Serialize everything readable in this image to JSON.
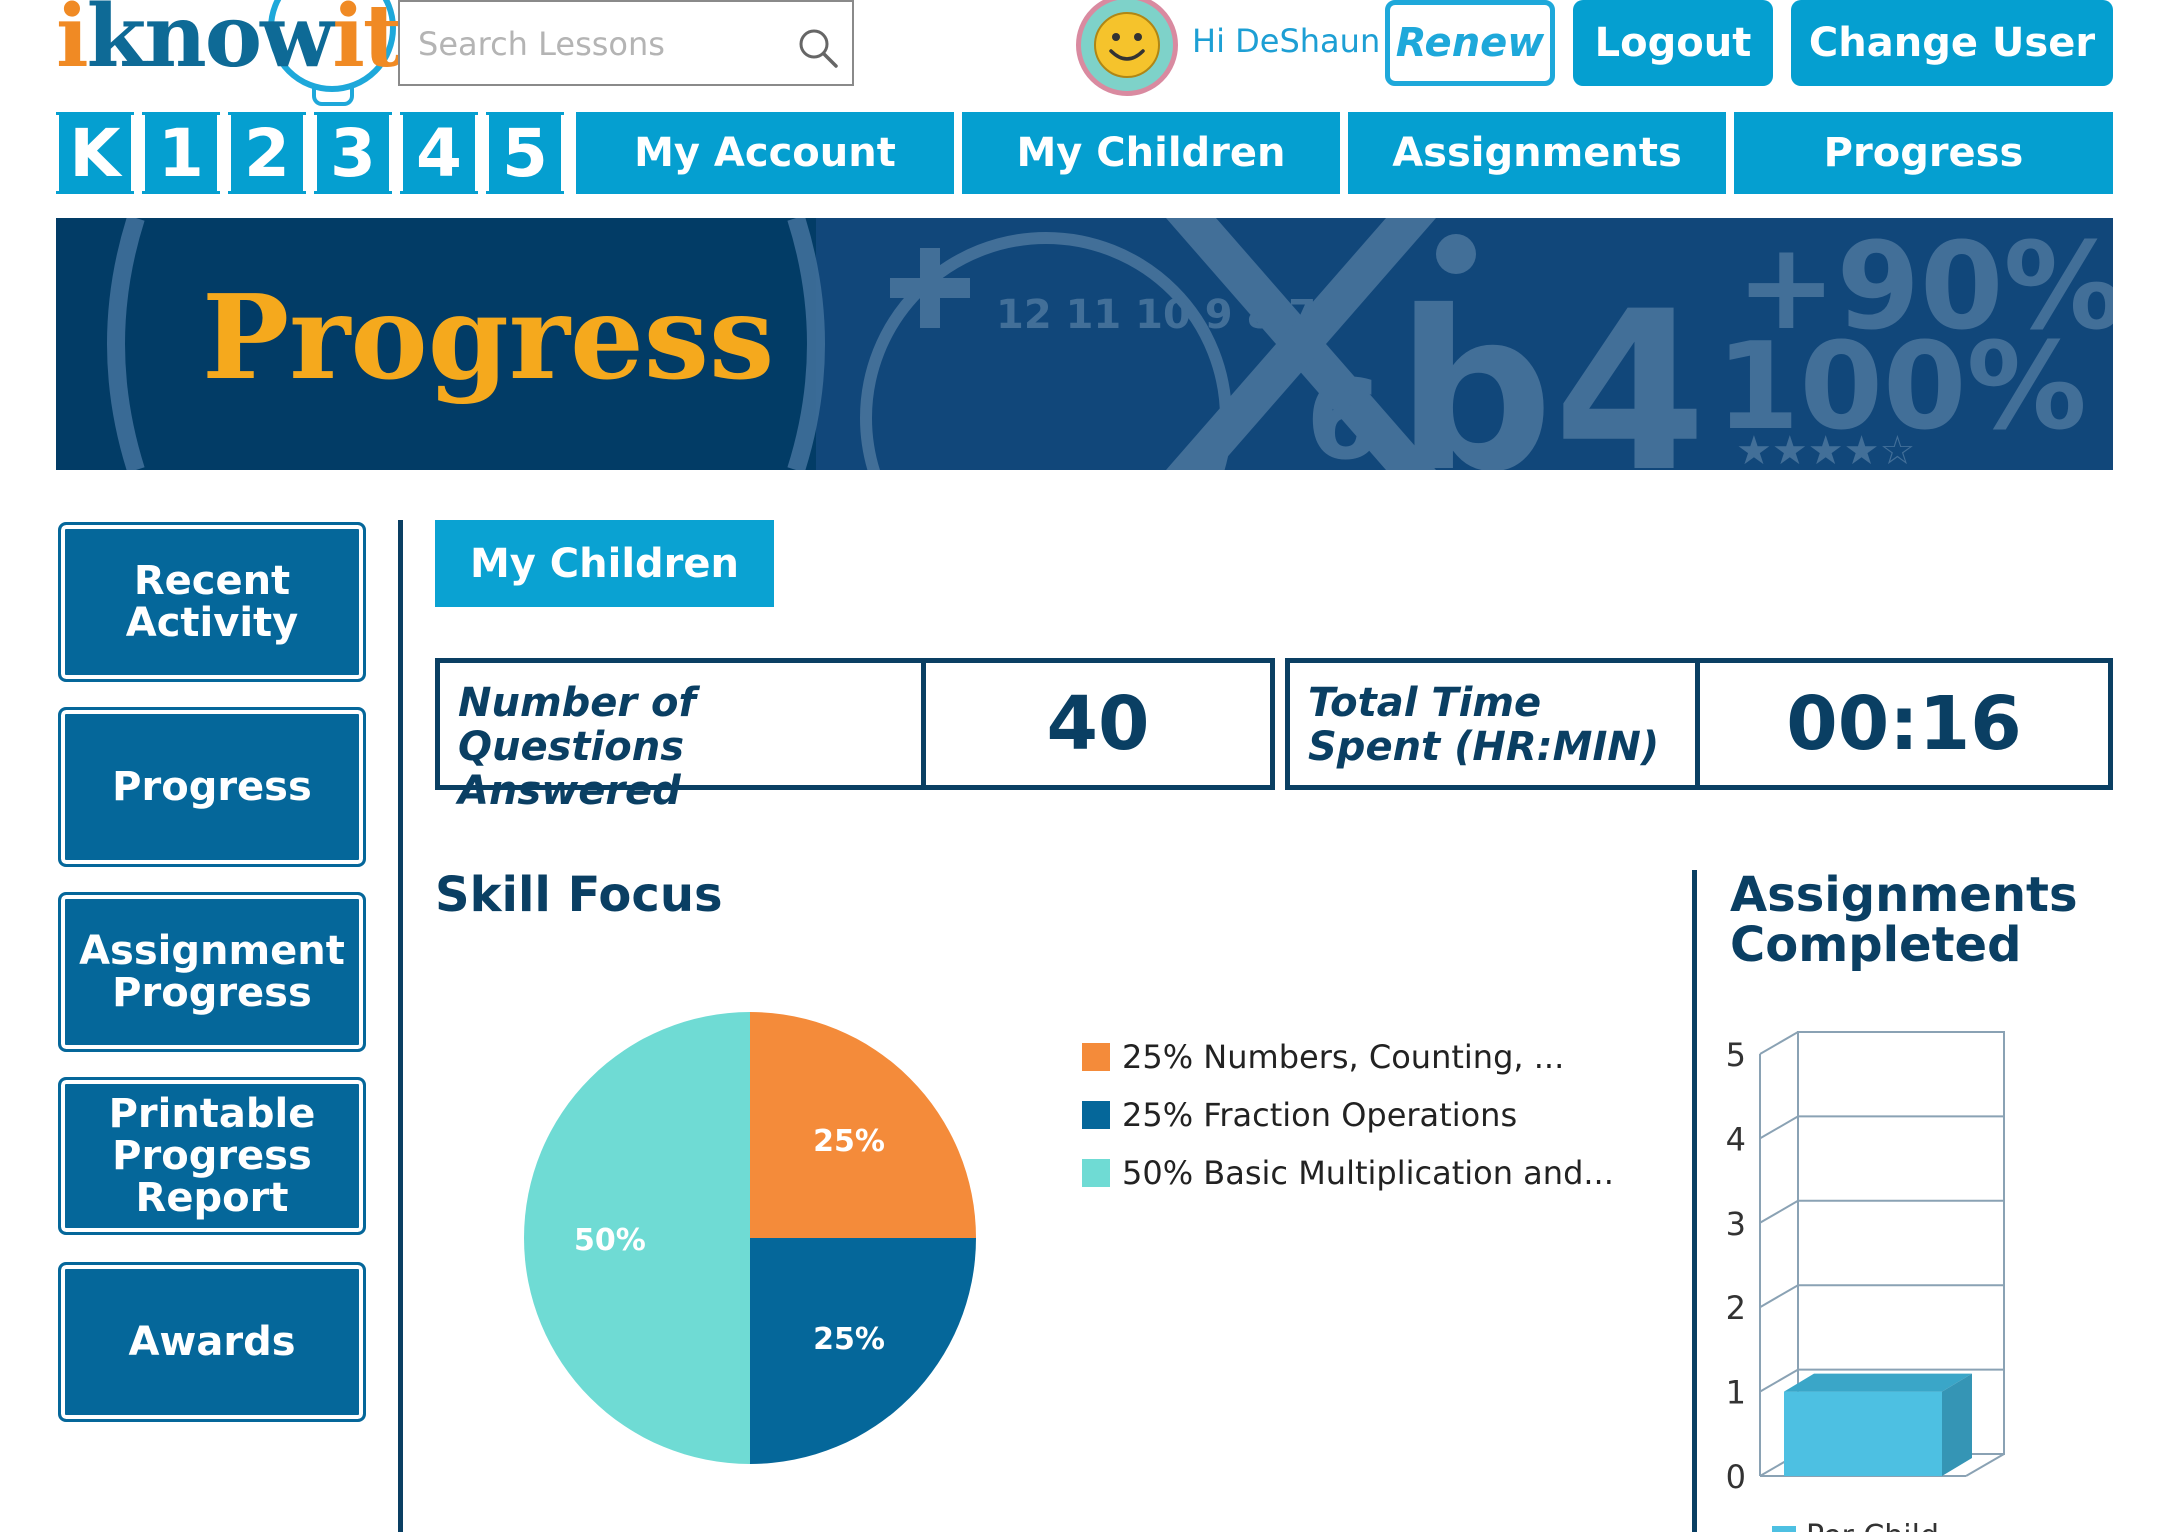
{
  "header": {
    "logo": "iknowit",
    "search_placeholder": "Search Lessons",
    "greeting": "Hi DeShaun",
    "renew_label": "Renew",
    "logout_label": "Logout",
    "change_user_label": "Change User"
  },
  "nav": {
    "grades": [
      "K",
      "1",
      "2",
      "3",
      "4",
      "5"
    ],
    "tabs": [
      "My Account",
      "My Children",
      "Assignments",
      "Progress"
    ]
  },
  "banner": {
    "title": "Progress"
  },
  "sidebar": {
    "items": [
      "Recent Activity",
      "Progress",
      "Assignment Progress",
      "Printable Progress Report",
      "Awards"
    ]
  },
  "main": {
    "tab": "My Children",
    "stats": {
      "questions_label": "Number of Questions Answered",
      "questions_value": "40",
      "time_label": "Total Time Spent (HR:MIN)",
      "time_value": "00:16"
    },
    "skill_focus_title": "Skill Focus",
    "assignments_title": "Assignments Completed"
  },
  "colors": {
    "orange": "#f48b3a",
    "dark_blue": "#05679a",
    "teal": "#6fdbd4",
    "bar": "#4dc0e2"
  },
  "chart_data": [
    {
      "type": "pie",
      "title": "Skill Focus",
      "slices": [
        {
          "label": "25% Numbers, Counting, ...",
          "value": 25,
          "display": "25%",
          "color": "#f48b3a"
        },
        {
          "label": "25% Fraction Operations",
          "value": 25,
          "display": "25%",
          "color": "#05679a"
        },
        {
          "label": "50% Basic Multiplication and...",
          "value": 50,
          "display": "50%",
          "color": "#6fdbd4"
        }
      ]
    },
    {
      "type": "bar",
      "title": "Assignments Completed",
      "categories": [
        ""
      ],
      "series": [
        {
          "name": "Per Child",
          "values": [
            1
          ]
        }
      ],
      "ylim": [
        0,
        5
      ],
      "yticks": [
        "0",
        "1",
        "2",
        "3",
        "4",
        "5"
      ]
    }
  ]
}
